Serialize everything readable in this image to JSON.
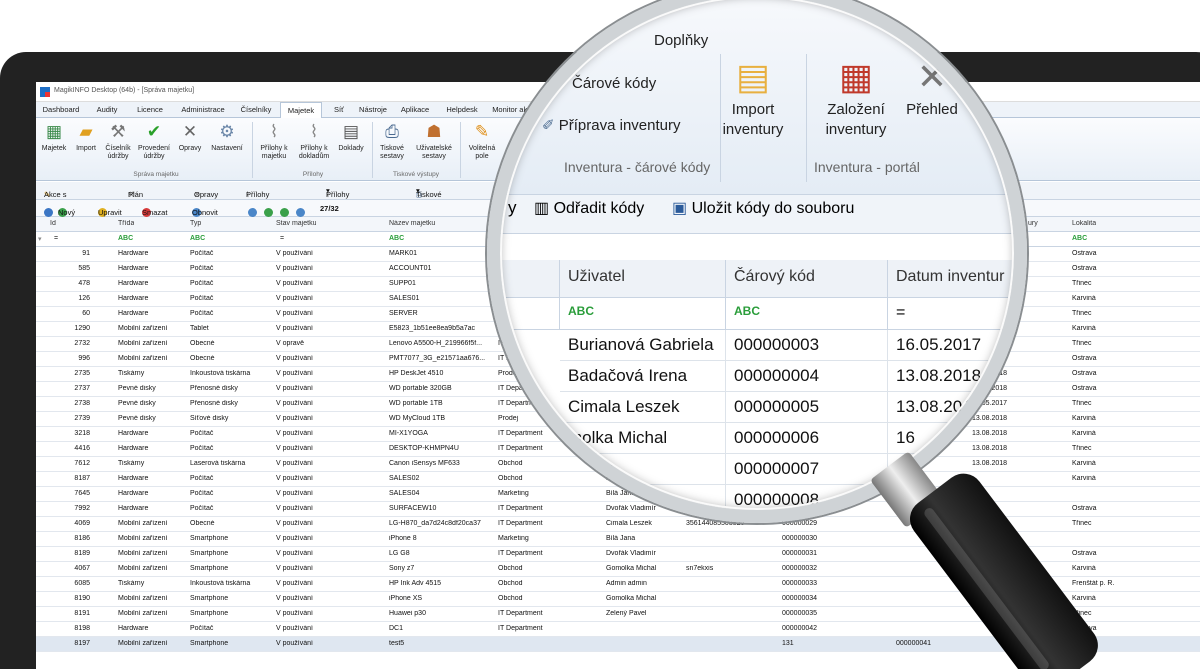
{
  "window": {
    "title": "MagikINFO Desktop (64b) - [Správa majetku]"
  },
  "tabs": [
    "Dashboard",
    "Audity",
    "Licence",
    "Administrace",
    "Číselníky",
    "Majetek",
    "Síť",
    "Nástroje",
    "Aplikace",
    "Helpdesk",
    "Monitor aktr"
  ],
  "ribbon": {
    "buttons": [
      "Majetek",
      "Import",
      "Číselník údržby",
      "Provedení údržby",
      "Opravy",
      "Nastavení",
      "Přílohy k majetku",
      "Přílohy k dokladům",
      "Doklady",
      "Tiskové sestavy",
      "Uživatelské sestavy",
      "Volitelná pole"
    ],
    "groups": [
      "Správa majetku",
      "Přílohy",
      "Tiskové výstupy"
    ]
  },
  "actions": [
    "Akce s majetkem",
    "Plán údržby",
    "Opravy",
    "Přílohy k majetku",
    "Přílohy k dokladu",
    "Tiskové sestavy"
  ],
  "nav": {
    "new": "Nový",
    "edit": "Upravit",
    "delete": "Smazat",
    "refresh": "Obnovit",
    "counter": "27/32"
  },
  "grid": {
    "headers": [
      "Id",
      "Třída",
      "Typ",
      "Stav majetku",
      "Název majetku",
      "ury",
      "Lokalita"
    ],
    "filter_abc": "ABC",
    "rows": [
      {
        "id": "91",
        "trida": "Hardware",
        "typ": "Počítač",
        "stav": "V používání",
        "nazev": "MARK01",
        "oddeleni": "",
        "uzivatel": "",
        "kod": "",
        "ser": "",
        "c1": "",
        "c2": "",
        "lokalita": "Ostrava"
      },
      {
        "id": "585",
        "trida": "Hardware",
        "typ": "Počítač",
        "stav": "V používání",
        "nazev": "ACCOUNT01",
        "oddeleni": "",
        "uzivatel": "",
        "kod": "",
        "ser": "",
        "c1": "",
        "c2": "",
        "lokalita": "Ostrava"
      },
      {
        "id": "478",
        "trida": "Hardware",
        "typ": "Počítač",
        "stav": "V používání",
        "nazev": "SUPP01",
        "oddeleni": "",
        "uzivatel": "",
        "kod": "",
        "ser": "",
        "c1": "",
        "c2": "",
        "lokalita": "Třinec"
      },
      {
        "id": "126",
        "trida": "Hardware",
        "typ": "Počítač",
        "stav": "V používání",
        "nazev": "SALES01",
        "oddeleni": "",
        "uzivatel": "",
        "kod": "",
        "ser": "",
        "c1": "",
        "c2": "",
        "lokalita": "Karviná"
      },
      {
        "id": "60",
        "trida": "Hardware",
        "typ": "Počítač",
        "stav": "V používání",
        "nazev": "SERVER",
        "oddeleni": "",
        "uzivatel": "",
        "kod": "",
        "ser": "",
        "c1": "",
        "c2": "",
        "lokalita": "Třinec"
      },
      {
        "id": "1290",
        "trida": "Mobilní zařízení",
        "typ": "Tablet",
        "stav": "V používání",
        "nazev": "E5823_1b51ee8ea9b5a7ac",
        "oddeleni": "M",
        "uzivatel": "",
        "kod": "",
        "ser": "",
        "c1": "",
        "c2": "018",
        "lokalita": "Karviná"
      },
      {
        "id": "2732",
        "trida": "Mobilní zařízení",
        "typ": "Obecné",
        "stav": "V opravě",
        "nazev": "Lenovo A5500-H_219966f5f...",
        "oddeleni": "IT D",
        "uzivatel": "",
        "kod": "",
        "ser": "",
        "c1": "",
        "c2": "018",
        "lokalita": "Třinec"
      },
      {
        "id": "996",
        "trida": "Mobilní zařízení",
        "typ": "Obecné",
        "stav": "V používání",
        "nazev": "PMT7077_3G_e21571aa676...",
        "oddeleni": "IT De",
        "uzivatel": "",
        "kod": "",
        "ser": "",
        "c1": "",
        "c2": "018",
        "lokalita": "Ostrava"
      },
      {
        "id": "2735",
        "trida": "Tiskárny",
        "typ": "Inkoustová tiskárna",
        "stav": "V používání",
        "nazev": "HP DeskJet 4510",
        "oddeleni": "Prodej",
        "uzivatel": "",
        "kod": "",
        "ser": "",
        "c1": "",
        "c2": "13.08.2018",
        "lokalita": "Ostrava"
      },
      {
        "id": "2737",
        "trida": "Pevné disky",
        "typ": "Přenosné disky",
        "stav": "V používání",
        "nazev": "WD portable 320GB",
        "oddeleni": "IT Depart",
        "uzivatel": "",
        "kod": "",
        "ser": "",
        "c1": "",
        "c2": "13.08.2018",
        "lokalita": "Ostrava"
      },
      {
        "id": "2738",
        "trida": "Pevné disky",
        "typ": "Přenosné disky",
        "stav": "V používání",
        "nazev": "WD portable 1TB",
        "oddeleni": "IT Departm",
        "uzivatel": "",
        "kod": "",
        "ser": "",
        "c1": "",
        "c2": "16.05.2017",
        "lokalita": "Třinec"
      },
      {
        "id": "2739",
        "trida": "Pevné disky",
        "typ": "Síťové disky",
        "stav": "V používání",
        "nazev": "WD MyCloud 1TB",
        "oddeleni": "Prodej",
        "uzivatel": "",
        "kod": "",
        "ser": "",
        "c1": "",
        "c2": "13.08.2018",
        "lokalita": "Karviná"
      },
      {
        "id": "3218",
        "trida": "Hardware",
        "typ": "Počítač",
        "stav": "V používání",
        "nazev": "MI-X1YOGA",
        "oddeleni": "IT Department",
        "uzivatel": "",
        "kod": "",
        "ser": "",
        "c1": "",
        "c2": "13.08.2018",
        "lokalita": "Karviná"
      },
      {
        "id": "4416",
        "trida": "Hardware",
        "typ": "Počítač",
        "stav": "V používání",
        "nazev": "DESKTOP-KHMPN4U",
        "oddeleni": "IT Department",
        "uzivatel": "",
        "kod": "",
        "ser": "",
        "c1": "",
        "c2": "13.08.2018",
        "lokalita": "Třinec"
      },
      {
        "id": "7612",
        "trida": "Tiskárny",
        "typ": "Laserová tiskárna",
        "stav": "V používání",
        "nazev": "Canon iSensys MF633",
        "oddeleni": "Obchod",
        "uzivatel": "",
        "kod": "",
        "ser": "",
        "c1": "0021",
        "c2": "13.08.2018",
        "lokalita": "Karviná"
      },
      {
        "id": "8187",
        "trida": "Hardware",
        "typ": "Počítač",
        "stav": "V používání",
        "nazev": "SALES02",
        "oddeleni": "Obchod",
        "uzivatel": "Kubič",
        "kod": "",
        "ser": "",
        "c1": "026",
        "c2": "",
        "lokalita": "Karviná"
      },
      {
        "id": "7645",
        "trida": "Hardware",
        "typ": "Počítač",
        "stav": "V používání",
        "nazev": "SALES04",
        "oddeleni": "Marketing",
        "uzivatel": "Bílá Jana",
        "kod": "",
        "ser": "",
        "c1": "7",
        "c2": "",
        "lokalita": ""
      },
      {
        "id": "7992",
        "trida": "Hardware",
        "typ": "Počítač",
        "stav": "V používání",
        "nazev": "SURFACEW10",
        "oddeleni": "IT Department",
        "uzivatel": "Dvořák Vladimír",
        "kod": "003051",
        "ser": "",
        "c1": "",
        "c2": "",
        "lokalita": "Ostrava"
      },
      {
        "id": "4069",
        "trida": "Mobilní zařízení",
        "typ": "Obecné",
        "stav": "V používání",
        "nazev": "LG-H870_da7d24c8df20ca37",
        "oddeleni": "IT Department",
        "uzivatel": "Cimala Leszek",
        "kod": "356144085503825",
        "ser": "000000029",
        "c1": "",
        "c2": "",
        "lokalita": "Třinec"
      },
      {
        "id": "8186",
        "trida": "Mobilní zařízení",
        "typ": "Smartphone",
        "stav": "V používání",
        "nazev": "iPhone 8",
        "oddeleni": "Marketing",
        "uzivatel": "Bílá Jana",
        "kod": "",
        "ser": "000000030",
        "c1": "",
        "c2": "",
        "lokalita": ""
      },
      {
        "id": "8189",
        "trida": "Mobilní zařízení",
        "typ": "Smartphone",
        "stav": "V používání",
        "nazev": "LG G8",
        "oddeleni": "IT Department",
        "uzivatel": "Dvořák Vladimír",
        "kod": "",
        "ser": "000000031",
        "c1": "",
        "c2": "",
        "lokalita": "Ostrava"
      },
      {
        "id": "4067",
        "trida": "Mobilní zařízení",
        "typ": "Smartphone",
        "stav": "V používání",
        "nazev": "Sony z7",
        "oddeleni": "Obchod",
        "uzivatel": "Gomolka Michal",
        "kod": "sn7ekxis",
        "ser": "000000032",
        "c1": "",
        "c2": "07.2017",
        "lokalita": "Karviná"
      },
      {
        "id": "6085",
        "trida": "Tiskárny",
        "typ": "Inkoustová tiskárna",
        "stav": "V používání",
        "nazev": "HP Ink Adv 4515",
        "oddeleni": "Obchod",
        "uzivatel": "Admin admin",
        "kod": "",
        "ser": "000000033",
        "c1": "",
        "c2": "",
        "lokalita": "Frenštát p. R."
      },
      {
        "id": "8190",
        "trida": "Mobilní zařízení",
        "typ": "Smartphone",
        "stav": "V používání",
        "nazev": "iPhone XS",
        "oddeleni": "Obchod",
        "uzivatel": "Gomolka Michal",
        "kod": "",
        "ser": "000000034",
        "c1": "",
        "c2": "",
        "lokalita": "Karviná"
      },
      {
        "id": "8191",
        "trida": "Mobilní zařízení",
        "typ": "Smartphone",
        "stav": "V používání",
        "nazev": "Huawei p30",
        "oddeleni": "IT Department",
        "uzivatel": "Zelený Pavel",
        "kod": "",
        "ser": "000000035",
        "c1": "",
        "c2": "",
        "lokalita": "Třinec"
      },
      {
        "id": "8198",
        "trida": "Hardware",
        "typ": "Počítač",
        "stav": "V používání",
        "nazev": "DC1",
        "oddeleni": "IT Department",
        "uzivatel": "",
        "kod": "",
        "ser": "000000042",
        "c1": "",
        "c2": "",
        "lokalita": "Ostrava"
      },
      {
        "id": "8197",
        "trida": "Mobilní zařízení",
        "typ": "Smartphone",
        "stav": "V používání",
        "nazev": "test5",
        "oddeleni": "",
        "uzivatel": "",
        "kod": "",
        "ser": "131",
        "c1": "000000041",
        "c2": "",
        "lokalita": "Ostrava"
      }
    ]
  },
  "lens": {
    "tab": "Doplňky",
    "buttons": [
      "Čárové kódy",
      "Příprava inventury",
      "Import",
      "inventury",
      "Založení",
      "inventury",
      "Přehled"
    ],
    "groups": [
      "Inventura - čárové kódy",
      "Inventura - portál"
    ],
    "toolbar": [
      "Odřadit kódy",
      "Uložit kódy do souboru"
    ],
    "headers": [
      "Uživatel",
      "Čárový kód",
      "Datum inventur"
    ],
    "rows": [
      {
        "user": "Burianová Gabriela",
        "code": "000000003",
        "date": "16.05.2017"
      },
      {
        "user": "Badačová Irena",
        "code": "000000004",
        "date": "13.08.2018"
      },
      {
        "user": "Cimala Leszek",
        "code": "000000005",
        "date": "13.08.2018"
      },
      {
        "user": "molka Michal",
        "code": "000000006",
        "date": "16"
      },
      {
        "user": "eszek",
        "code": "000000007",
        "date": ""
      },
      {
        "user": "",
        "code": "000000008",
        "date": ""
      }
    ]
  }
}
